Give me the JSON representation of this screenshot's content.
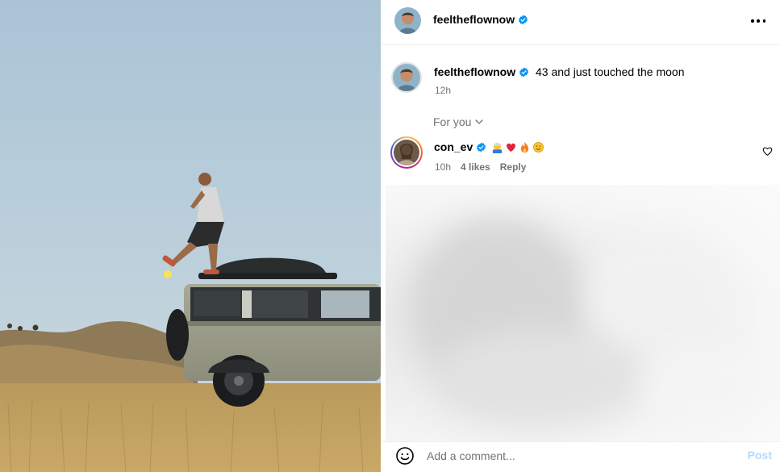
{
  "post": {
    "author": "feeltheflownow",
    "photo_description_icon": "post-photo"
  },
  "caption": {
    "username": "feeltheflownow",
    "text": "43 and just touched the moon",
    "time": "12h"
  },
  "comments_filter": {
    "label": "For you"
  },
  "comments": [
    {
      "username": "con_ev",
      "emojis": [
        "old-man-emoji",
        "red-heart-emoji",
        "fire-emoji",
        "smiley-emoji"
      ],
      "time": "10h",
      "likes": "4 likes",
      "reply_label": "Reply"
    }
  ],
  "composer": {
    "placeholder": "Add a comment...",
    "post_label": "Post"
  },
  "colors": {
    "verified_blue": "#0095f6",
    "post_button_disabled": "#b3dbff",
    "secondary_text": "#737373"
  }
}
